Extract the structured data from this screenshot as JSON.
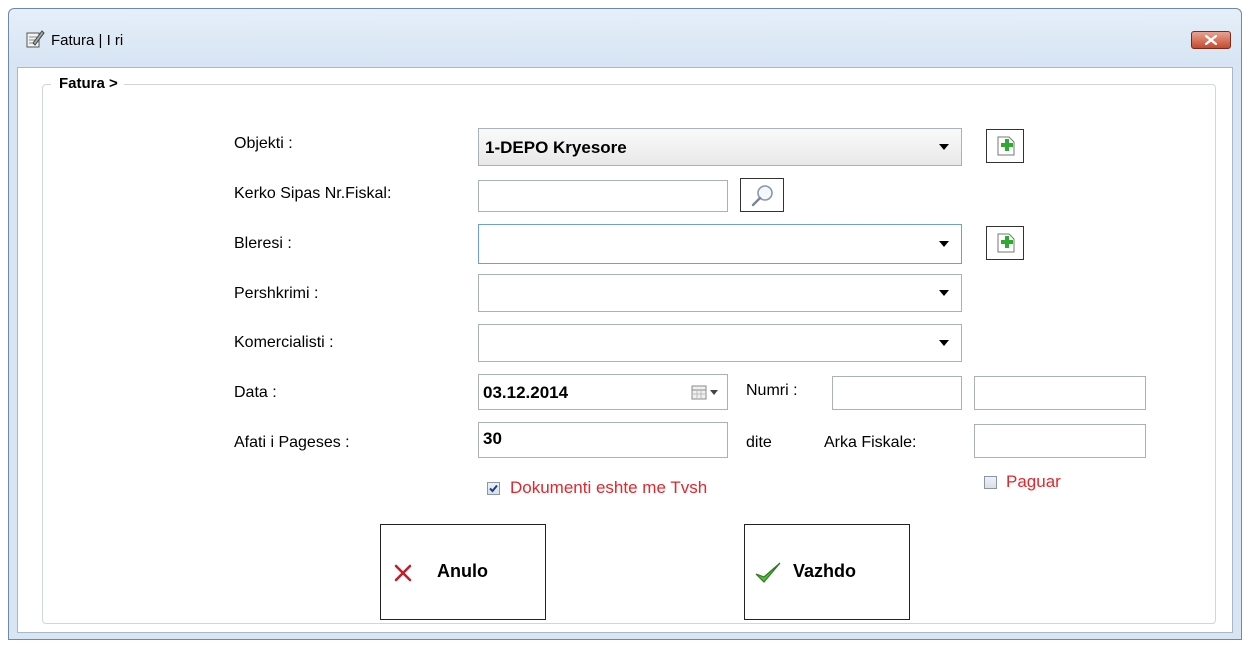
{
  "window": {
    "title": "Fatura | I ri"
  },
  "group": {
    "title": "Fatura >"
  },
  "form": {
    "objekti": {
      "label": "Objekti :",
      "value": "1-DEPO Kryesore"
    },
    "kerko": {
      "label": "Kerko Sipas Nr.Fiskal:",
      "value": ""
    },
    "bleresi": {
      "label": "Bleresi :",
      "value": ""
    },
    "pershkrimi": {
      "label": "Pershkrimi :",
      "value": ""
    },
    "komercialisti": {
      "label": "Komercialisti :",
      "value": ""
    },
    "data": {
      "label": "Data :",
      "value": "03.12.2014"
    },
    "numri": {
      "label": "Numri :",
      "value1": "",
      "value2": ""
    },
    "afati": {
      "label": "Afati i Pageses :",
      "value": "30",
      "unit": "dite"
    },
    "arka": {
      "label": "Arka Fiskale:",
      "value": ""
    },
    "tvsh": {
      "label": "Dokumenti eshte me Tvsh",
      "checked": true
    },
    "paguar": {
      "label": "Paguar",
      "checked": false
    }
  },
  "buttons": {
    "anulo": "Anulo",
    "vazhdo": "Vazhdo"
  },
  "icons": {
    "app": "edit-document-icon",
    "close": "close-icon",
    "add": "add-document-icon",
    "search": "magnifier-icon",
    "calendar": "calendar-icon",
    "cancel": "x-mark-icon",
    "ok": "checkmark-icon"
  },
  "colors": {
    "accent_red": "#e3262b",
    "add_green": "#2eaa2e",
    "close_red": "#c64a2f"
  }
}
